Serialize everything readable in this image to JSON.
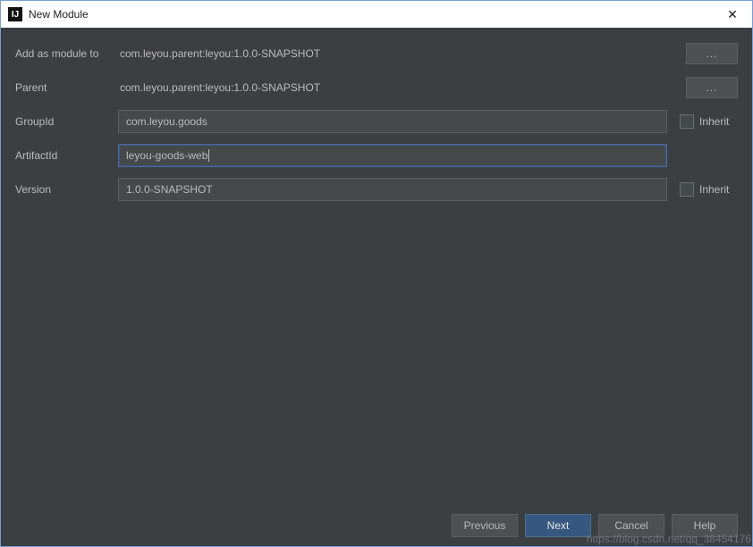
{
  "titlebar": {
    "icon_text": "IJ",
    "title": "New Module",
    "close_label": "✕"
  },
  "form": {
    "add_as_module_to": {
      "label": "Add as module to",
      "value": "com.leyou.parent:leyou:1.0.0-SNAPSHOT",
      "ellipsis": "..."
    },
    "parent": {
      "label": "Parent",
      "value": "com.leyou.parent:leyou:1.0.0-SNAPSHOT",
      "ellipsis": "..."
    },
    "group_id": {
      "label": "GroupId",
      "value": "com.leyou.goods",
      "inherit_label": "Inherit"
    },
    "artifact_id": {
      "label": "ArtifactId",
      "value": "leyou-goods-web"
    },
    "version": {
      "label": "Version",
      "value": "1.0.0-SNAPSHOT",
      "inherit_label": "Inherit"
    }
  },
  "buttons": {
    "previous": "Previous",
    "next": "Next",
    "cancel": "Cancel",
    "help": "Help"
  },
  "watermark": "https://blog.csdn.net/qq_38454176"
}
